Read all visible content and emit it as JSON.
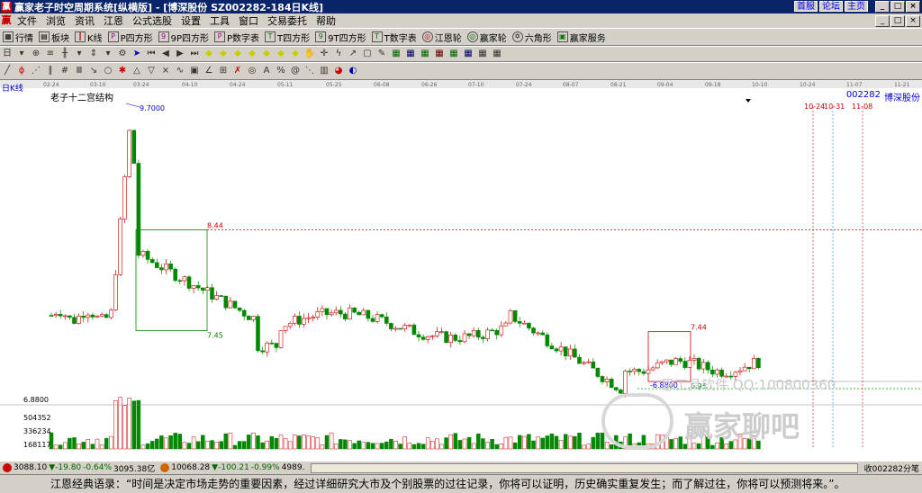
{
  "window": {
    "title": "赢家老子时空周期系统[纵横版] - [博深股份  SZ002282-184日K线]",
    "links": [
      "首服",
      "论坛",
      "主页"
    ]
  },
  "menu": [
    "文件",
    "浏览",
    "资讯",
    "江恩",
    "公式选股",
    "设置",
    "工具",
    "窗口",
    "交易委托",
    "帮助"
  ],
  "toolbar1": [
    "行情",
    "板块",
    "K线",
    "P四方形",
    "9P四方形",
    "P数字表",
    "T四方形",
    "9T四方形",
    "T数字表",
    "江恩轮",
    "赢家轮",
    "六角形",
    "赢家服务"
  ],
  "chart": {
    "period_label": "日K线",
    "structure_label": "老子十二宫结构",
    "code": "002282",
    "name": "博深股份",
    "dates": [
      "02-24",
      "03-10",
      "03-24",
      "04-10",
      "04-24",
      "05-11",
      "05-25",
      "06-08",
      "06-26",
      "07-10",
      "07-24",
      "08-07",
      "08-21",
      "09-04",
      "09-18",
      "10-10",
      "10-24",
      "11-07",
      "11-21"
    ],
    "future_dates": [
      "10-24",
      "10-31",
      "11-08"
    ],
    "annotations": [
      "9.7000",
      "8.44",
      "7.45",
      "7.44",
      "6.95",
      "-6.8800",
      "6.8800"
    ],
    "volume_ticks": [
      "504352",
      "336234",
      "168117"
    ],
    "watermark": "恩工具软件  QQ:100800360",
    "watermark2": "赢家聊吧"
  },
  "status": {
    "sh": "3088.10",
    "sh_chg": "▼-19.80",
    "sh_pct": "-0.64%",
    "sh_vol": "3095.38亿",
    "sz": "10068.28",
    "sz_chg": "▼-100.21",
    "sz_pct": "-0.99%",
    "sz_vol": "4989.",
    "right": "收002282分笔"
  },
  "footer": "江恩经典语录：“时间是决定市场走势的重要因素，经过详细研究大市及个别股票的过往记录，你将可以证明，历史确实重复发生；而了解过往，你将可以预测将来。”。"
}
